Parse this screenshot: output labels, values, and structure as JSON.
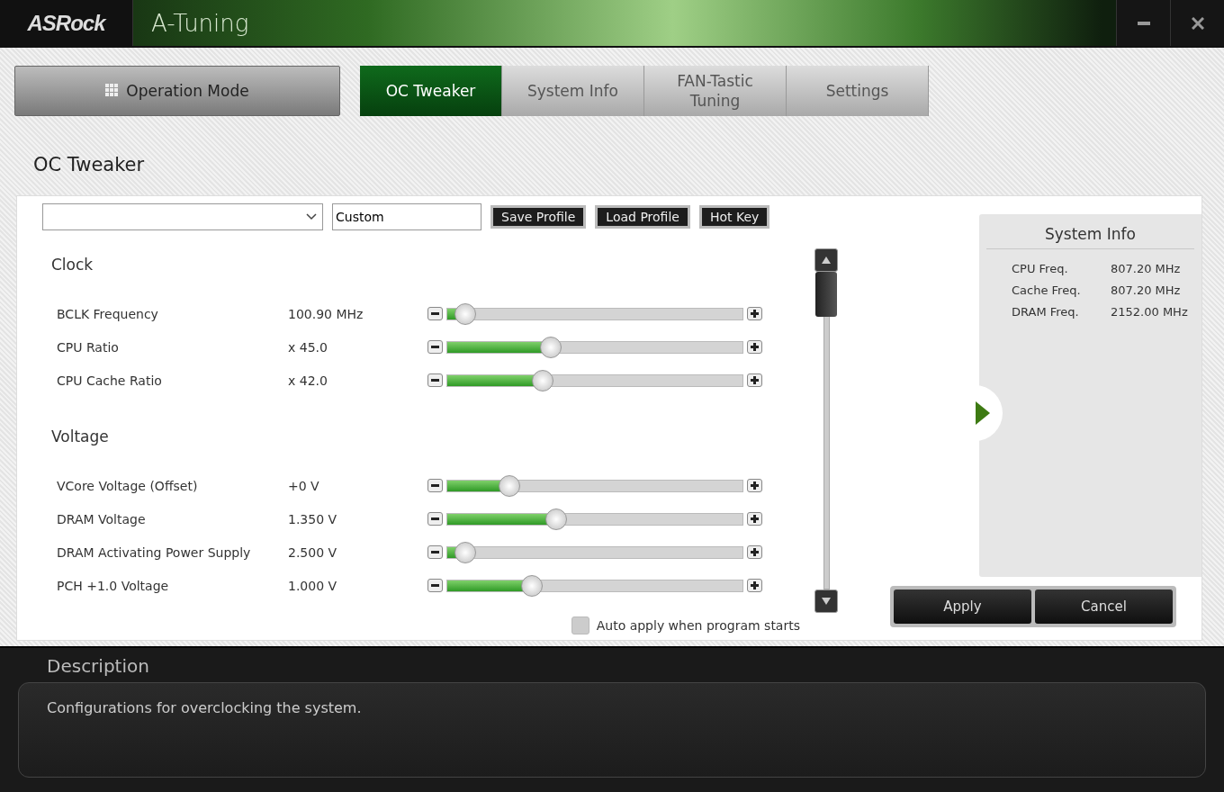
{
  "window": {
    "logo": "ASRock",
    "title": "A-Tuning"
  },
  "mode_button": {
    "label": "Operation Mode"
  },
  "tabs": [
    {
      "label": "OC Tweaker",
      "selected": true
    },
    {
      "label": "System Info",
      "selected": false
    },
    {
      "label": "FAN-Tastic Tuning",
      "selected": false
    },
    {
      "label": "Settings",
      "selected": false
    }
  ],
  "page_title": "OC Tweaker",
  "profile": {
    "name": "Custom",
    "buttons": [
      "Save Profile",
      "Load Profile",
      "Hot Key"
    ]
  },
  "sections": [
    {
      "title": "Clock",
      "rows": [
        {
          "name": "BCLK Frequency",
          "reading": "100.90 MHz",
          "level": 0.03
        },
        {
          "name": "CPU Ratio",
          "reading": "x 45.0",
          "level": 0.34
        },
        {
          "name": "CPU Cache Ratio",
          "reading": "x 42.0",
          "level": 0.31
        }
      ]
    },
    {
      "title": "Voltage",
      "rows": [
        {
          "name": "VCore Voltage (Offset)",
          "reading": "+0 V",
          "level": 0.19
        },
        {
          "name": "DRAM Voltage",
          "reading": "1.350 V",
          "level": 0.36
        },
        {
          "name": "DRAM Activating Power Supply",
          "reading": "2.500 V",
          "level": 0.03
        },
        {
          "name": "PCH +1.0 Voltage",
          "reading": "1.000 V",
          "level": 0.27
        }
      ]
    }
  ],
  "auto_apply": {
    "label": "Auto apply when program starts",
    "checked": false
  },
  "system_info": {
    "title": "System Info",
    "items": [
      {
        "label": "CPU Freq.",
        "value": "807.20 MHz"
      },
      {
        "label": "Cache Freq.",
        "value": "807.20 MHz"
      },
      {
        "label": "DRAM Freq.",
        "value": "2152.00 MHz"
      }
    ]
  },
  "actions": [
    "Apply",
    "Cancel"
  ],
  "description": {
    "title": "Description",
    "text": "Configurations for overclocking the system."
  }
}
